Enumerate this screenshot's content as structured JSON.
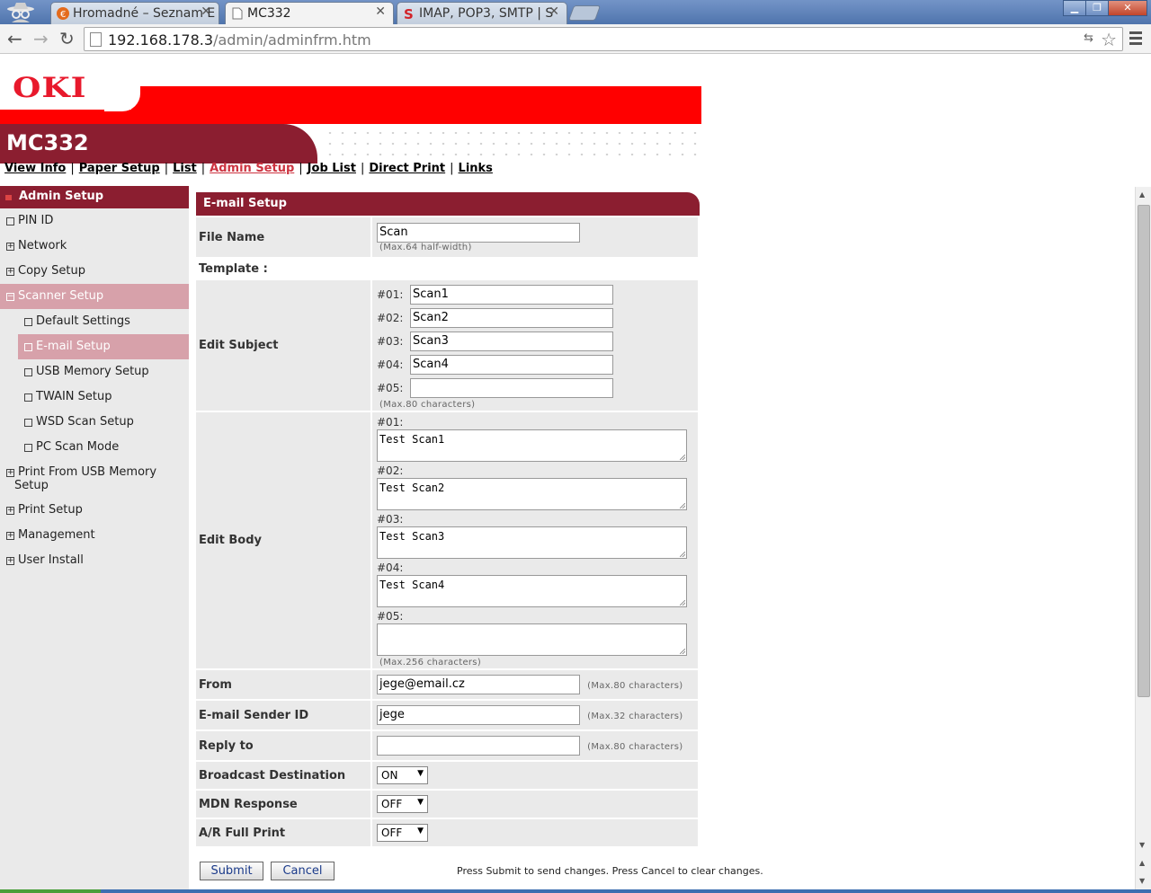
{
  "browser": {
    "tabs": [
      {
        "title": "Hromadné – Seznam E"
      },
      {
        "title": "MC332"
      },
      {
        "title": "IMAP, POP3, SMTP | S"
      }
    ],
    "url_host": "192.168.178.3",
    "url_path": "/admin/adminfrm.htm"
  },
  "header": {
    "brand": "OKI",
    "model": "MC332"
  },
  "topnav": {
    "items": [
      "View Info",
      "Paper Setup",
      "List",
      "Admin Setup",
      "Job List",
      "Direct Print",
      "Links"
    ],
    "separator": "|"
  },
  "sidebar": {
    "title": "Admin Setup",
    "items": [
      {
        "label": "PIN ID",
        "marker": "□"
      },
      {
        "label": "Network",
        "marker": "⊞"
      },
      {
        "label": "Copy Setup",
        "marker": "⊞"
      },
      {
        "label": "Scanner Setup",
        "marker": "⊟"
      },
      {
        "label": "Default Settings",
        "marker": "□"
      },
      {
        "label": "E-mail Setup",
        "marker": "□"
      },
      {
        "label": "USB Memory Setup",
        "marker": "□"
      },
      {
        "label": "TWAIN Setup",
        "marker": "□"
      },
      {
        "label": "WSD Scan Setup",
        "marker": "□"
      },
      {
        "label": "PC Scan Mode",
        "marker": "□"
      },
      {
        "label": "Print From USB Memory",
        "label2": "Setup",
        "marker": "⊞"
      },
      {
        "label": "Print Setup",
        "marker": "⊞"
      },
      {
        "label": "Management",
        "marker": "⊞"
      },
      {
        "label": "User Install",
        "marker": "⊞"
      }
    ]
  },
  "form": {
    "title": "E-mail Setup",
    "file_name": {
      "label": "File Name",
      "value": "Scan",
      "hint": "(Max.64 half-width)"
    },
    "template_label": "Template :",
    "edit_subject": {
      "label": "Edit Subject",
      "rows": [
        {
          "num": "#01:",
          "value": "Scan1"
        },
        {
          "num": "#02:",
          "value": "Scan2"
        },
        {
          "num": "#03:",
          "value": "Scan3"
        },
        {
          "num": "#04:",
          "value": "Scan4"
        },
        {
          "num": "#05:",
          "value": ""
        }
      ],
      "hint": "(Max.80 characters)"
    },
    "edit_body": {
      "label": "Edit Body",
      "rows": [
        {
          "num": "#01:",
          "value": "Test Scan1"
        },
        {
          "num": "#02:",
          "value": "Test Scan2"
        },
        {
          "num": "#03:",
          "value": "Test Scan3"
        },
        {
          "num": "#04:",
          "value": "Test Scan4"
        },
        {
          "num": "#05:",
          "value": ""
        }
      ],
      "hint": "(Max.256 characters)"
    },
    "from": {
      "label": "From",
      "value": "jege@email.cz",
      "hint": "(Max.80 characters)"
    },
    "sender_id": {
      "label": "E-mail Sender ID",
      "value": "jege",
      "hint": "(Max.32 characters)"
    },
    "reply_to": {
      "label": "Reply to",
      "value": "",
      "hint": "(Max.80 characters)"
    },
    "broadcast": {
      "label": "Broadcast Destination",
      "value": "ON"
    },
    "mdn": {
      "label": "MDN Response",
      "value": "OFF"
    },
    "ar_full_print": {
      "label": "A/R Full Print",
      "value": "OFF"
    }
  },
  "footer": {
    "submit": "Submit",
    "cancel": "Cancel",
    "message": "Press Submit to send changes. Press Cancel to clear changes."
  },
  "colors": {
    "brand_red": "#ff0000",
    "dark_red": "#8b1e30",
    "menu_highlight": "#d7a1aa",
    "active_link": "#cc3340"
  }
}
